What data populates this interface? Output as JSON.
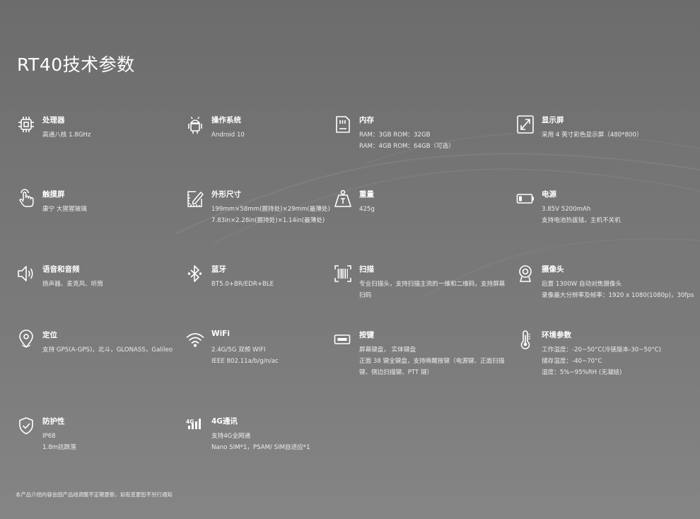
{
  "page": {
    "title": "RT40技术参数",
    "footer": "本产品介绍内容会因产品线调整不定期更新，如有变更恕不另行通知"
  },
  "specs": [
    {
      "icon": "cpu-icon",
      "name": "处理器",
      "lines": [
        "高通八核 1.8GHz"
      ]
    },
    {
      "icon": "android-icon",
      "name": "操作系统",
      "lines": [
        "Android 10"
      ]
    },
    {
      "icon": "memory-card-icon",
      "name": "内存",
      "lines": [
        "RAM：3GB ROM：32GB",
        "RAM：4GB ROM：64GB（可选）"
      ]
    },
    {
      "icon": "display-expand-icon",
      "name": "显示屏",
      "lines": [
        "采用 4 英寸彩色显示屏（480*800）"
      ]
    },
    {
      "icon": "touch-hand-icon",
      "name": "触摸屏",
      "lines": [
        "康宁 大猩猩玻璃"
      ]
    },
    {
      "icon": "ruler-edit-icon",
      "name": "外形尺寸",
      "lines": [
        "199mm×58mm(握持处)×29mm(最薄处)",
        "7.83in×2.28in(握持处)×1.14in(最薄处)"
      ]
    },
    {
      "icon": "weight-icon",
      "name": "重量",
      "lines": [
        "425g"
      ]
    },
    {
      "icon": "battery-icon",
      "name": "电源",
      "lines": [
        "3.85V 5200mAh",
        "支持电池热拔插，主机不关机"
      ]
    },
    {
      "icon": "speaker-icon",
      "name": "语音和音频",
      "lines": [
        "扬声器、麦克风、听筒"
      ]
    },
    {
      "icon": "bluetooth-icon",
      "name": "蓝牙",
      "lines": [
        "BT5.0+BR/EDR+BLE"
      ]
    },
    {
      "icon": "barcode-scan-icon",
      "name": "扫描",
      "lines": [
        "专业扫描头，支持扫描主流的一维和二维码，支持屏幕扫码"
      ]
    },
    {
      "icon": "webcam-icon",
      "name": "摄像头",
      "lines": [
        "后置 1300W 自动对焦摄像头",
        "录像最大分辨率及帧率：1920 x 1080(1080p)，30fps"
      ]
    },
    {
      "icon": "location-pin-icon",
      "name": "定位",
      "lines": [
        "支持 GPS(A-GPS)，北斗，GLONASS，Galileo"
      ]
    },
    {
      "icon": "wifi-icon",
      "name": "WiFi",
      "lines": [
        "2.4G/5G 双频 WIFI",
        "IEEE 802.11a/b/g/n/ac"
      ]
    },
    {
      "icon": "keyboard-key-icon",
      "name": "按键",
      "lines": [
        "屏幕键盘， 实体键盘",
        "正面 38 键全键盘，支持唤醒按键（电源键、正面扫描键、侧边扫描键、PTT 键）"
      ]
    },
    {
      "icon": "thermometer-icon",
      "name": "环境参数",
      "lines": [
        "工作温度：-20~50°C(冷链版本-30~50°C)",
        "储存温度：-40~70°C",
        "湿度：5%~95%RH (无凝结)"
      ]
    },
    {
      "icon": "shield-check-icon",
      "name": "防护性",
      "lines": [
        "IP68",
        "1.8m抗跌落"
      ]
    },
    {
      "icon": "signal-4g-icon",
      "name": "4G通讯",
      "lines": [
        "支持4G全网通",
        "Nano SIM*1，PSAM/ SIM自适应*1"
      ]
    }
  ]
}
